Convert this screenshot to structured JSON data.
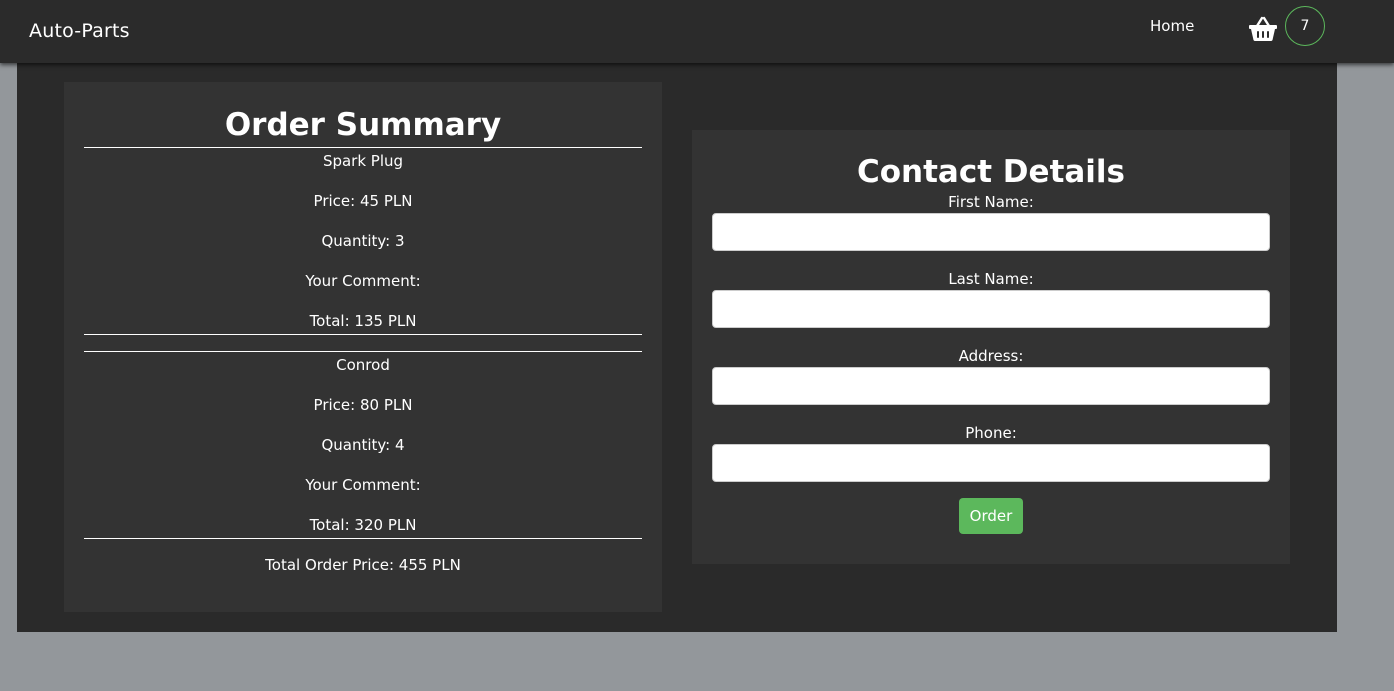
{
  "navbar": {
    "brand": "Auto-Parts",
    "home_label": "Home",
    "cart_icon": "basket-icon",
    "cart_count": "7",
    "badge_color": "#5cb85c"
  },
  "order_summary": {
    "title": "Order Summary",
    "items": [
      {
        "name": "Spark Plug",
        "price": "Price: 45 PLN",
        "quantity": "Quantity: 3",
        "comment": "Your Comment:",
        "total": "Total: 135 PLN"
      },
      {
        "name": "Conrod",
        "price": "Price: 80 PLN",
        "quantity": "Quantity: 4",
        "comment": "Your Comment:",
        "total": "Total: 320 PLN"
      }
    ],
    "total_order_price": "Total Order Price: 455 PLN"
  },
  "contact": {
    "title": "Contact Details",
    "fields": [
      {
        "label": "First Name:",
        "value": "",
        "placeholder": ""
      },
      {
        "label": "Last Name:",
        "value": "",
        "placeholder": ""
      },
      {
        "label": "Address:",
        "value": "",
        "placeholder": ""
      },
      {
        "label": "Phone:",
        "value": "",
        "placeholder": ""
      }
    ],
    "submit_label": "Order",
    "submit_color": "#5cb85c"
  }
}
